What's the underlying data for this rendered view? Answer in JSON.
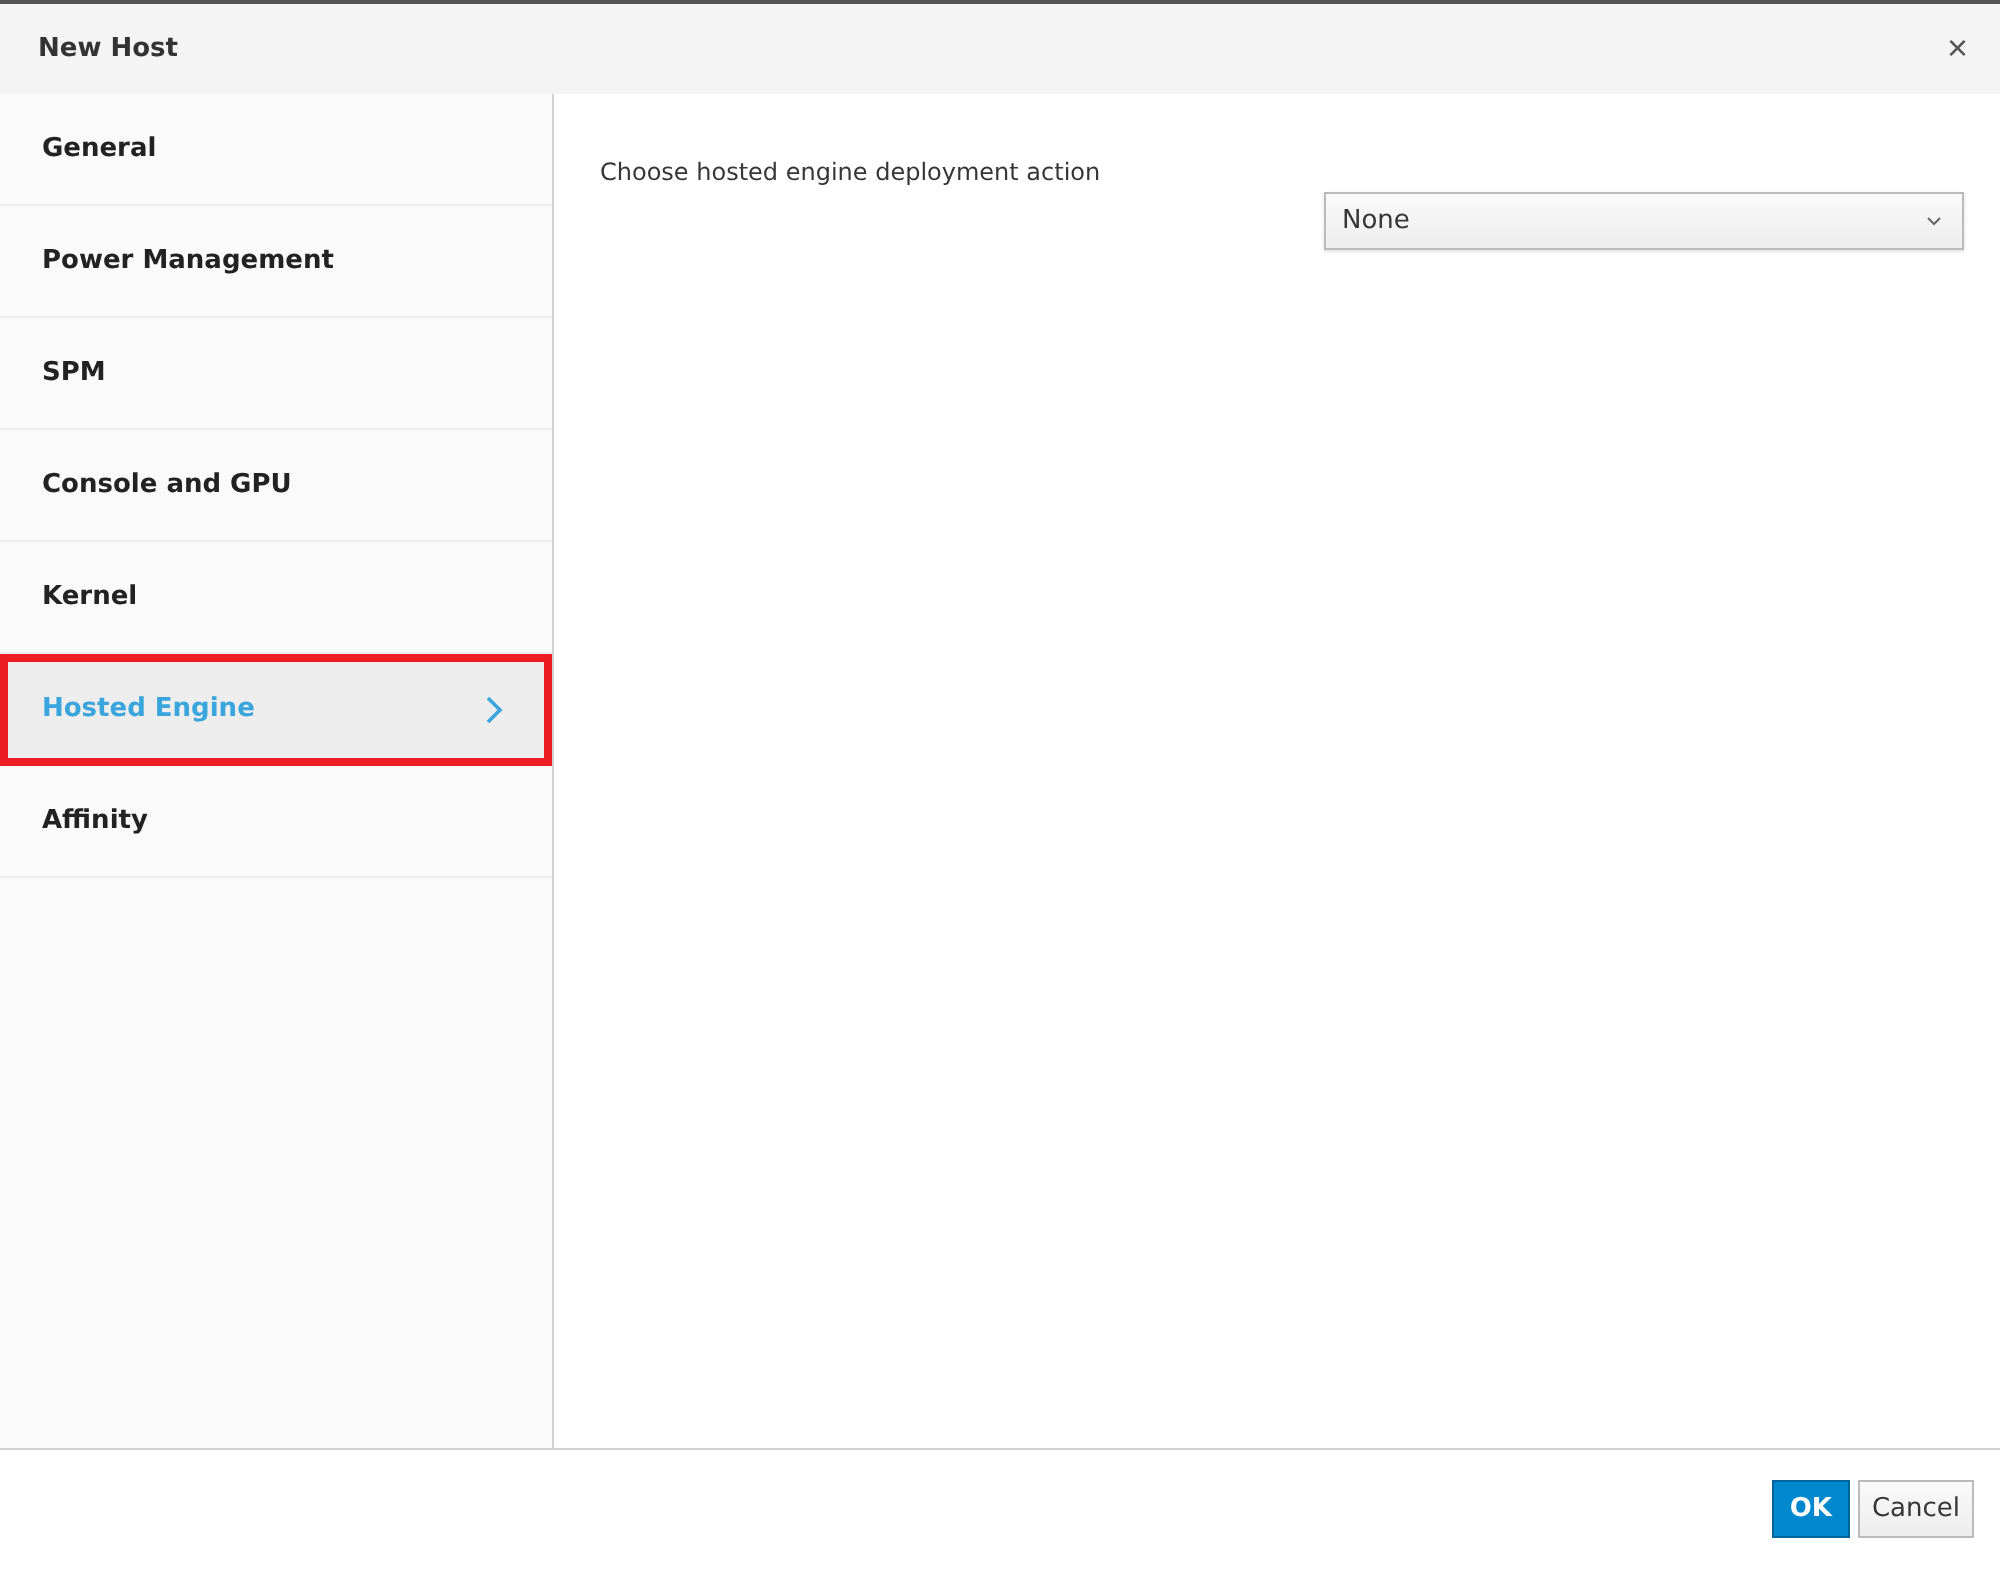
{
  "window": {
    "title": "New Host",
    "close": "×"
  },
  "sidebar": {
    "items": [
      {
        "label": "General",
        "selected": false,
        "highlighted": false
      },
      {
        "label": "Power Management",
        "selected": false,
        "highlighted": false
      },
      {
        "label": "SPM",
        "selected": false,
        "highlighted": false
      },
      {
        "label": "Console and GPU",
        "selected": false,
        "highlighted": false
      },
      {
        "label": "Kernel",
        "selected": false,
        "highlighted": false
      },
      {
        "label": "Hosted Engine",
        "selected": true,
        "highlighted": true
      },
      {
        "label": "Affinity",
        "selected": false,
        "highlighted": false
      }
    ]
  },
  "content": {
    "label": "Choose hosted engine deployment action",
    "select": {
      "value": "None"
    }
  },
  "buttons": [
    {
      "label": "OK",
      "kind": "primary"
    },
    {
      "label": "Cancel",
      "kind": "default"
    }
  ]
}
